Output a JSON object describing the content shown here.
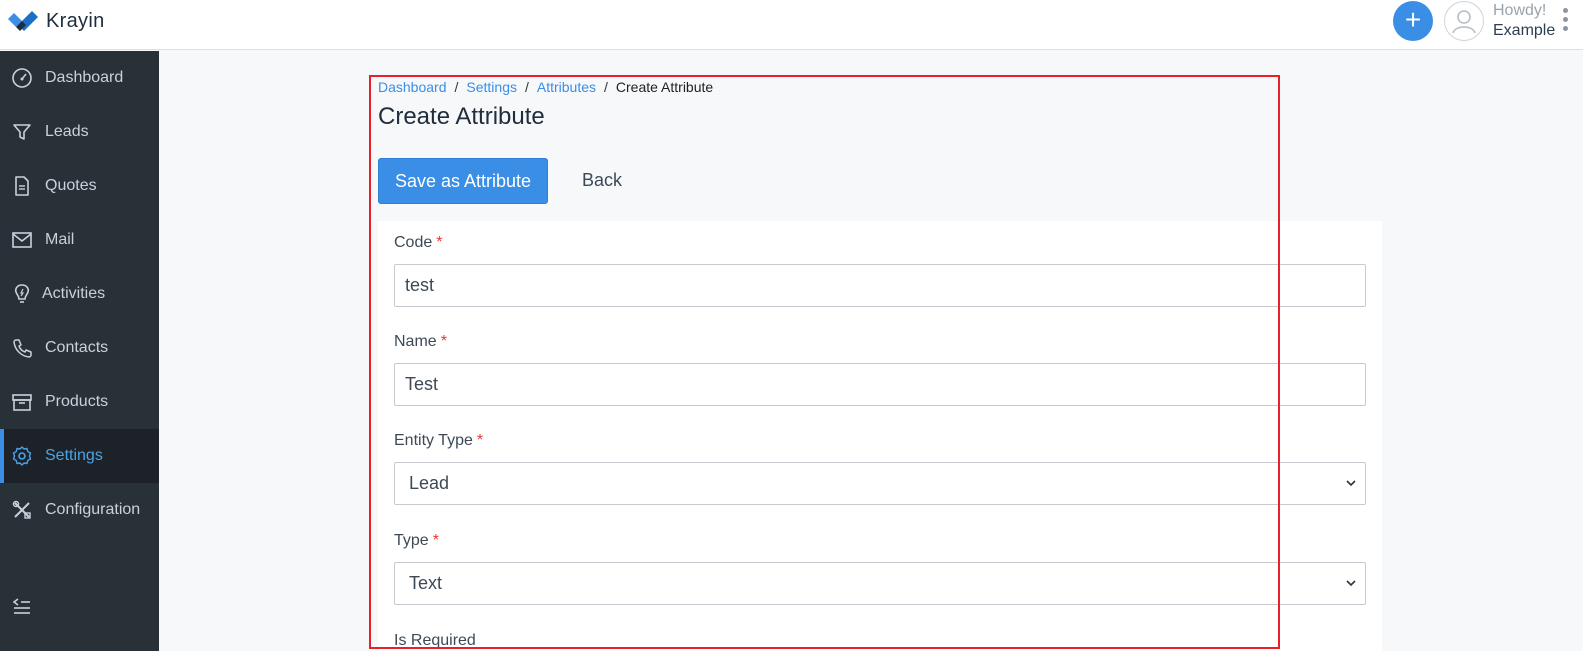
{
  "app": {
    "name": "Krayin"
  },
  "header": {
    "greeting": "Howdy!",
    "user_name": "Example"
  },
  "sidebar": {
    "items": [
      {
        "label": "Dashboard",
        "icon": "dashboard-gauge-icon"
      },
      {
        "label": "Leads",
        "icon": "filter-funnel-icon"
      },
      {
        "label": "Quotes",
        "icon": "document-icon"
      },
      {
        "label": "Mail",
        "icon": "mail-envelope-icon"
      },
      {
        "label": "Activities",
        "icon": "lightbulb-icon"
      },
      {
        "label": "Contacts",
        "icon": "phone-icon"
      },
      {
        "label": "Products",
        "icon": "archive-box-icon"
      },
      {
        "label": "Settings",
        "icon": "gear-icon",
        "active": true
      },
      {
        "label": "Configuration",
        "icon": "tools-icon"
      }
    ]
  },
  "breadcrumb": {
    "items": [
      "Dashboard",
      "Settings",
      "Attributes"
    ],
    "separator": "/",
    "current": "Create Attribute"
  },
  "page": {
    "title": "Create Attribute",
    "save_label": "Save as Attribute",
    "back_label": "Back"
  },
  "form": {
    "code": {
      "label": "Code",
      "required_mark": "*",
      "value": "test"
    },
    "name": {
      "label": "Name",
      "required_mark": "*",
      "value": "Test"
    },
    "entity_type": {
      "label": "Entity Type",
      "required_mark": "*",
      "selected": "Lead"
    },
    "type": {
      "label": "Type",
      "required_mark": "*",
      "selected": "Text"
    },
    "is_required": {
      "label": "Is Required"
    }
  },
  "colors": {
    "accent": "#3a8ee6",
    "sidebar_bg": "#283038",
    "required": "#e53935",
    "highlight_box": "#e8202a"
  }
}
